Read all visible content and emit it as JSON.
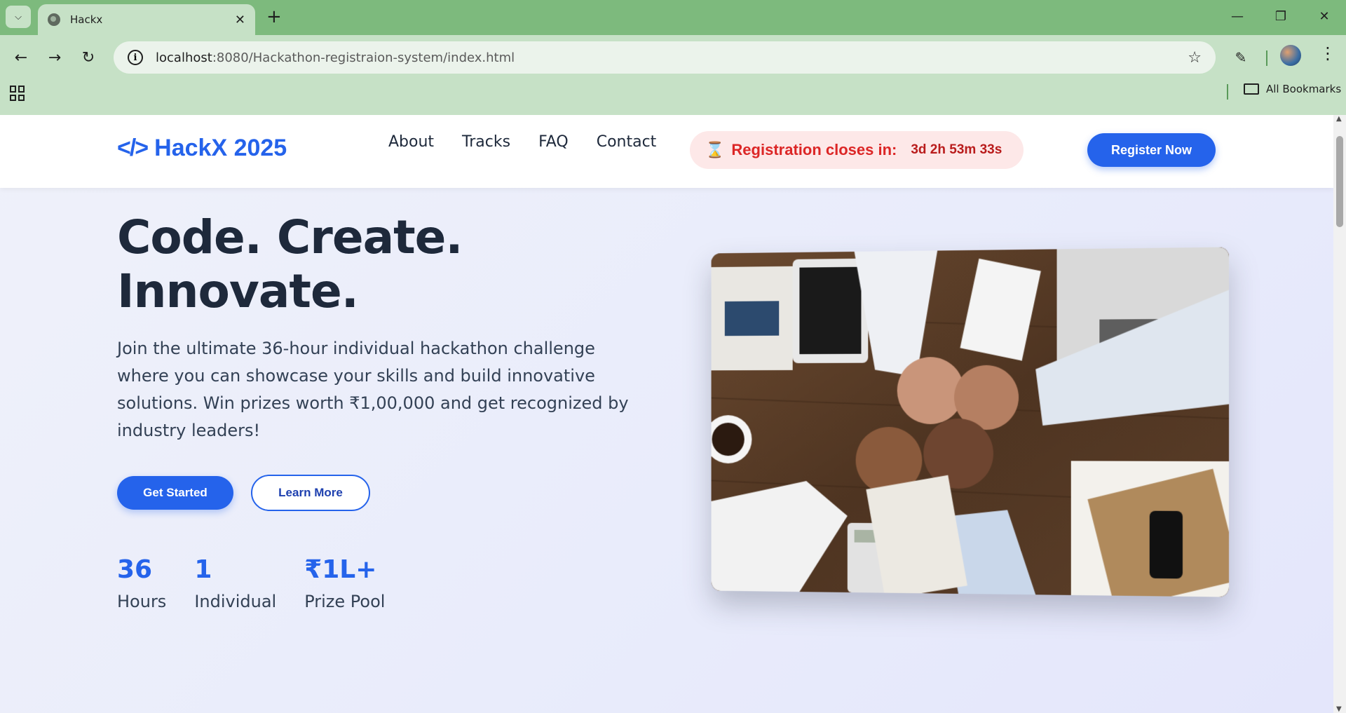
{
  "browser": {
    "tab_title": "Hackx",
    "url_host": "localhost",
    "url_rest": ":8080/Hackathon-registraion-system/index.html",
    "bookmarks_label": "All Bookmarks",
    "tab_bar_color": "#7dba7d",
    "toolbar_color": "#c6e1c6"
  },
  "header": {
    "logo_text": "HackX 2025",
    "nav": [
      "About",
      "Tracks",
      "FAQ",
      "Contact"
    ],
    "countdown_label": "Registration closes in:",
    "countdown_time": "3d 2h 53m 33s",
    "register_label": "Register Now",
    "accent_color": "#2563eb"
  },
  "hero": {
    "title_line1": "Code. Create.",
    "title_line2": "Innovate.",
    "description": "Join the ultimate 36-hour individual hackathon challenge where you can showcase your skills and build innovative solutions. Win prizes worth ₹1,00,000 and get recognized by industry leaders!",
    "primary_button": "Get Started",
    "secondary_button": "Learn More",
    "stats": [
      {
        "value": "36",
        "label": "Hours"
      },
      {
        "value": "1",
        "label": "Individual"
      },
      {
        "value": "₹1L+",
        "label": "Prize Pool"
      }
    ]
  }
}
